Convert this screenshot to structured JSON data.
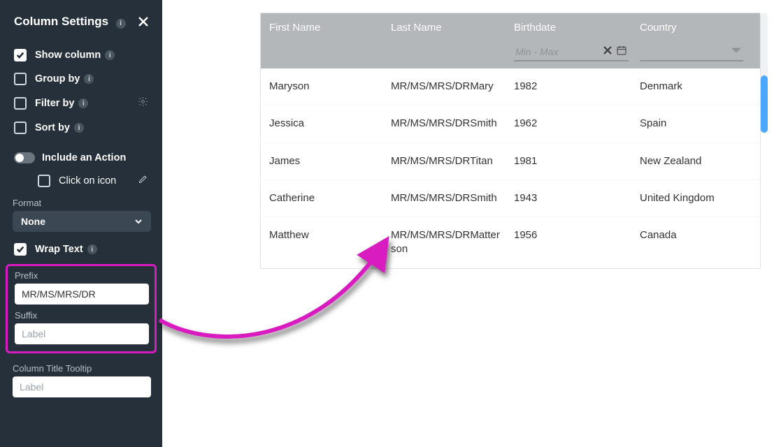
{
  "sidebar": {
    "title": "Column Settings",
    "show_column": "Show column",
    "group_by": "Group by",
    "filter_by": "Filter by",
    "sort_by": "Sort by",
    "include_action": "Include an Action",
    "click_on_icon": "Click on icon",
    "format_label": "Format",
    "format_value": "None",
    "wrap_text": "Wrap Text",
    "prefix_label": "Prefix",
    "prefix_value": "MR/MS/MRS/DR",
    "suffix_label": "Suffix",
    "suffix_placeholder": "Label",
    "tooltip_label": "Column Title Tooltip",
    "tooltip_placeholder": "Label"
  },
  "table": {
    "headers": {
      "first_name": "First Name",
      "last_name": "Last Name",
      "birthdate": "Birthdate",
      "country": "Country"
    },
    "filters": {
      "birthdate_placeholder": "Min - Max"
    },
    "rows": [
      {
        "first": "Maryson",
        "last": "MR/MS/MRS/DRMary",
        "birth": "1982",
        "country": "Denmark"
      },
      {
        "first": "Jessica",
        "last": "MR/MS/MRS/DRSmith",
        "birth": "1962",
        "country": "Spain"
      },
      {
        "first": "James",
        "last": "MR/MS/MRS/DRTitan",
        "birth": "1981",
        "country": "New Zealand"
      },
      {
        "first": "Catherine",
        "last": "MR/MS/MRS/DRSmith",
        "birth": "1943",
        "country": "United Kingdom"
      },
      {
        "first": "Matthew",
        "last": "MR/MS/MRS/DRMatterson",
        "birth": "1956",
        "country": "Canada"
      }
    ]
  },
  "colors": {
    "accent": "#d81bc0"
  }
}
